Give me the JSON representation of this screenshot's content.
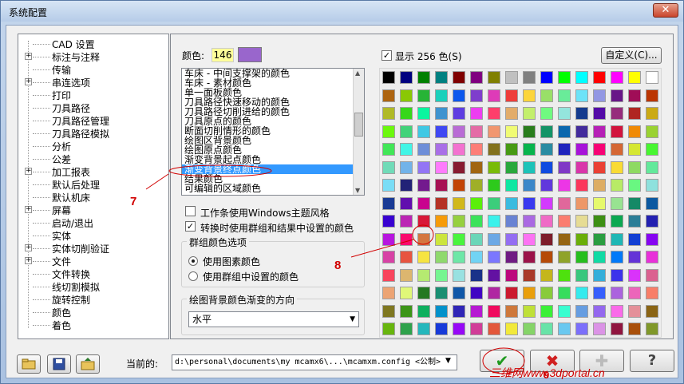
{
  "window": {
    "title": "系统配置",
    "close_symbol": "✕"
  },
  "tree": {
    "items": [
      {
        "label": "CAD 设置",
        "expandable": false
      },
      {
        "label": "标注与注释",
        "expandable": true
      },
      {
        "label": "传输",
        "expandable": false
      },
      {
        "label": "串连选项",
        "expandable": true
      },
      {
        "label": "打印",
        "expandable": false
      },
      {
        "label": "刀具路径",
        "expandable": false
      },
      {
        "label": "刀具路径管理",
        "expandable": false
      },
      {
        "label": "刀具路径模拟",
        "expandable": false
      },
      {
        "label": "分析",
        "expandable": false
      },
      {
        "label": "公差",
        "expandable": false
      },
      {
        "label": "加工报表",
        "expandable": true
      },
      {
        "label": "默认后处理",
        "expandable": false
      },
      {
        "label": "默认机床",
        "expandable": false
      },
      {
        "label": "屏幕",
        "expandable": true
      },
      {
        "label": "启动/退出",
        "expandable": false
      },
      {
        "label": "实体",
        "expandable": false
      },
      {
        "label": "实体切削验证",
        "expandable": true
      },
      {
        "label": "文件",
        "expandable": true
      },
      {
        "label": "文件转换",
        "expandable": false
      },
      {
        "label": "线切割模拟",
        "expandable": false
      },
      {
        "label": "旋转控制",
        "expandable": false
      },
      {
        "label": "颜色",
        "expandable": false
      },
      {
        "label": "着色",
        "expandable": false
      }
    ]
  },
  "color": {
    "label": "颜色:",
    "value": "146",
    "swatch": "#9966cc"
  },
  "color_list": {
    "items": [
      "车床 - 中间支撑架的颜色",
      "车床 - 素材颜色",
      "单一面板颜色",
      "刀具路径快速移动的颜色",
      "刀具路径切削进给的颜色",
      "刀具原点的颜色",
      "断面切削情形的颜色",
      "绘图区背景颜色",
      "绘图原点颜色",
      "渐变背景起点颜色",
      "渐变背景终点颜色",
      "结果颜色",
      "可编辑的区域颜色"
    ],
    "selected_index": 10
  },
  "options": {
    "toolbar_windows_theme": {
      "label": "工作条使用Windows主题风格",
      "checked": false
    },
    "use_group_result_colors": {
      "label": "转换时使用群组和结果中设置的颜色",
      "checked": true,
      "mark": "✓"
    }
  },
  "group_color": {
    "title": "群组颜色选项",
    "option1": "使用图素颜色",
    "option2": "使用群组中设置的颜色",
    "selected": 1
  },
  "gradient": {
    "title": "绘图背景颜色渐变的方向",
    "value": "水平",
    "arrow": "▼"
  },
  "palette": {
    "show_label": "显示 256 色(S)",
    "show_checked": true,
    "show_mark": "✓",
    "custom_button": "自定义(C)..."
  },
  "bottom": {
    "current_label": "当前的:",
    "path": "d:\\personal\\documents\\my mcamx6\\...\\mcamxm.config <公制>",
    "path_arrow": "▼"
  },
  "annotations": {
    "seven": "7",
    "eight": "8",
    "nine": "9"
  },
  "watermark": "三维网www.3dportal.cn",
  "icons": {
    "ok": "✔",
    "cancel": "✖",
    "add": "✚",
    "help": "?"
  },
  "colors": {
    "accent_selection": "#3399ff",
    "annotation_red": "#d10000"
  }
}
